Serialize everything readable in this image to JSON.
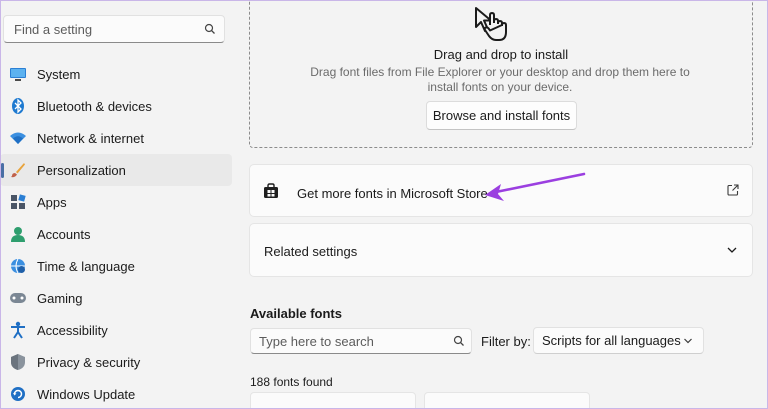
{
  "search": {
    "placeholder": "Find a setting"
  },
  "sidebar": {
    "items": [
      {
        "label": "System",
        "icon": "system-icon"
      },
      {
        "label": "Bluetooth & devices",
        "icon": "bluetooth-icon"
      },
      {
        "label": "Network & internet",
        "icon": "wifi-icon"
      },
      {
        "label": "Personalization",
        "icon": "brush-icon",
        "active": true
      },
      {
        "label": "Apps",
        "icon": "apps-icon"
      },
      {
        "label": "Accounts",
        "icon": "person-icon"
      },
      {
        "label": "Time & language",
        "icon": "globe-clock-icon"
      },
      {
        "label": "Gaming",
        "icon": "gamepad-icon"
      },
      {
        "label": "Accessibility",
        "icon": "accessibility-icon"
      },
      {
        "label": "Privacy & security",
        "icon": "shield-icon"
      },
      {
        "label": "Windows Update",
        "icon": "update-icon"
      }
    ]
  },
  "dropzone": {
    "title": "Drag and drop to install",
    "description": "Drag font files from File Explorer or your desktop and drop them here to install fonts on your device.",
    "button": "Browse and install fonts"
  },
  "store": {
    "label": "Get more fonts in Microsoft Store"
  },
  "related": {
    "label": "Related settings"
  },
  "available": {
    "title": "Available fonts",
    "search_placeholder": "Type here to search",
    "filter_label": "Filter by:",
    "filter_value": "Scripts for all languages",
    "count": "188 fonts found"
  },
  "colors": {
    "accent_arrow": "#9b3fe0",
    "active_indicator": "#4a6fa5",
    "window_border": "#c9b6e8"
  }
}
